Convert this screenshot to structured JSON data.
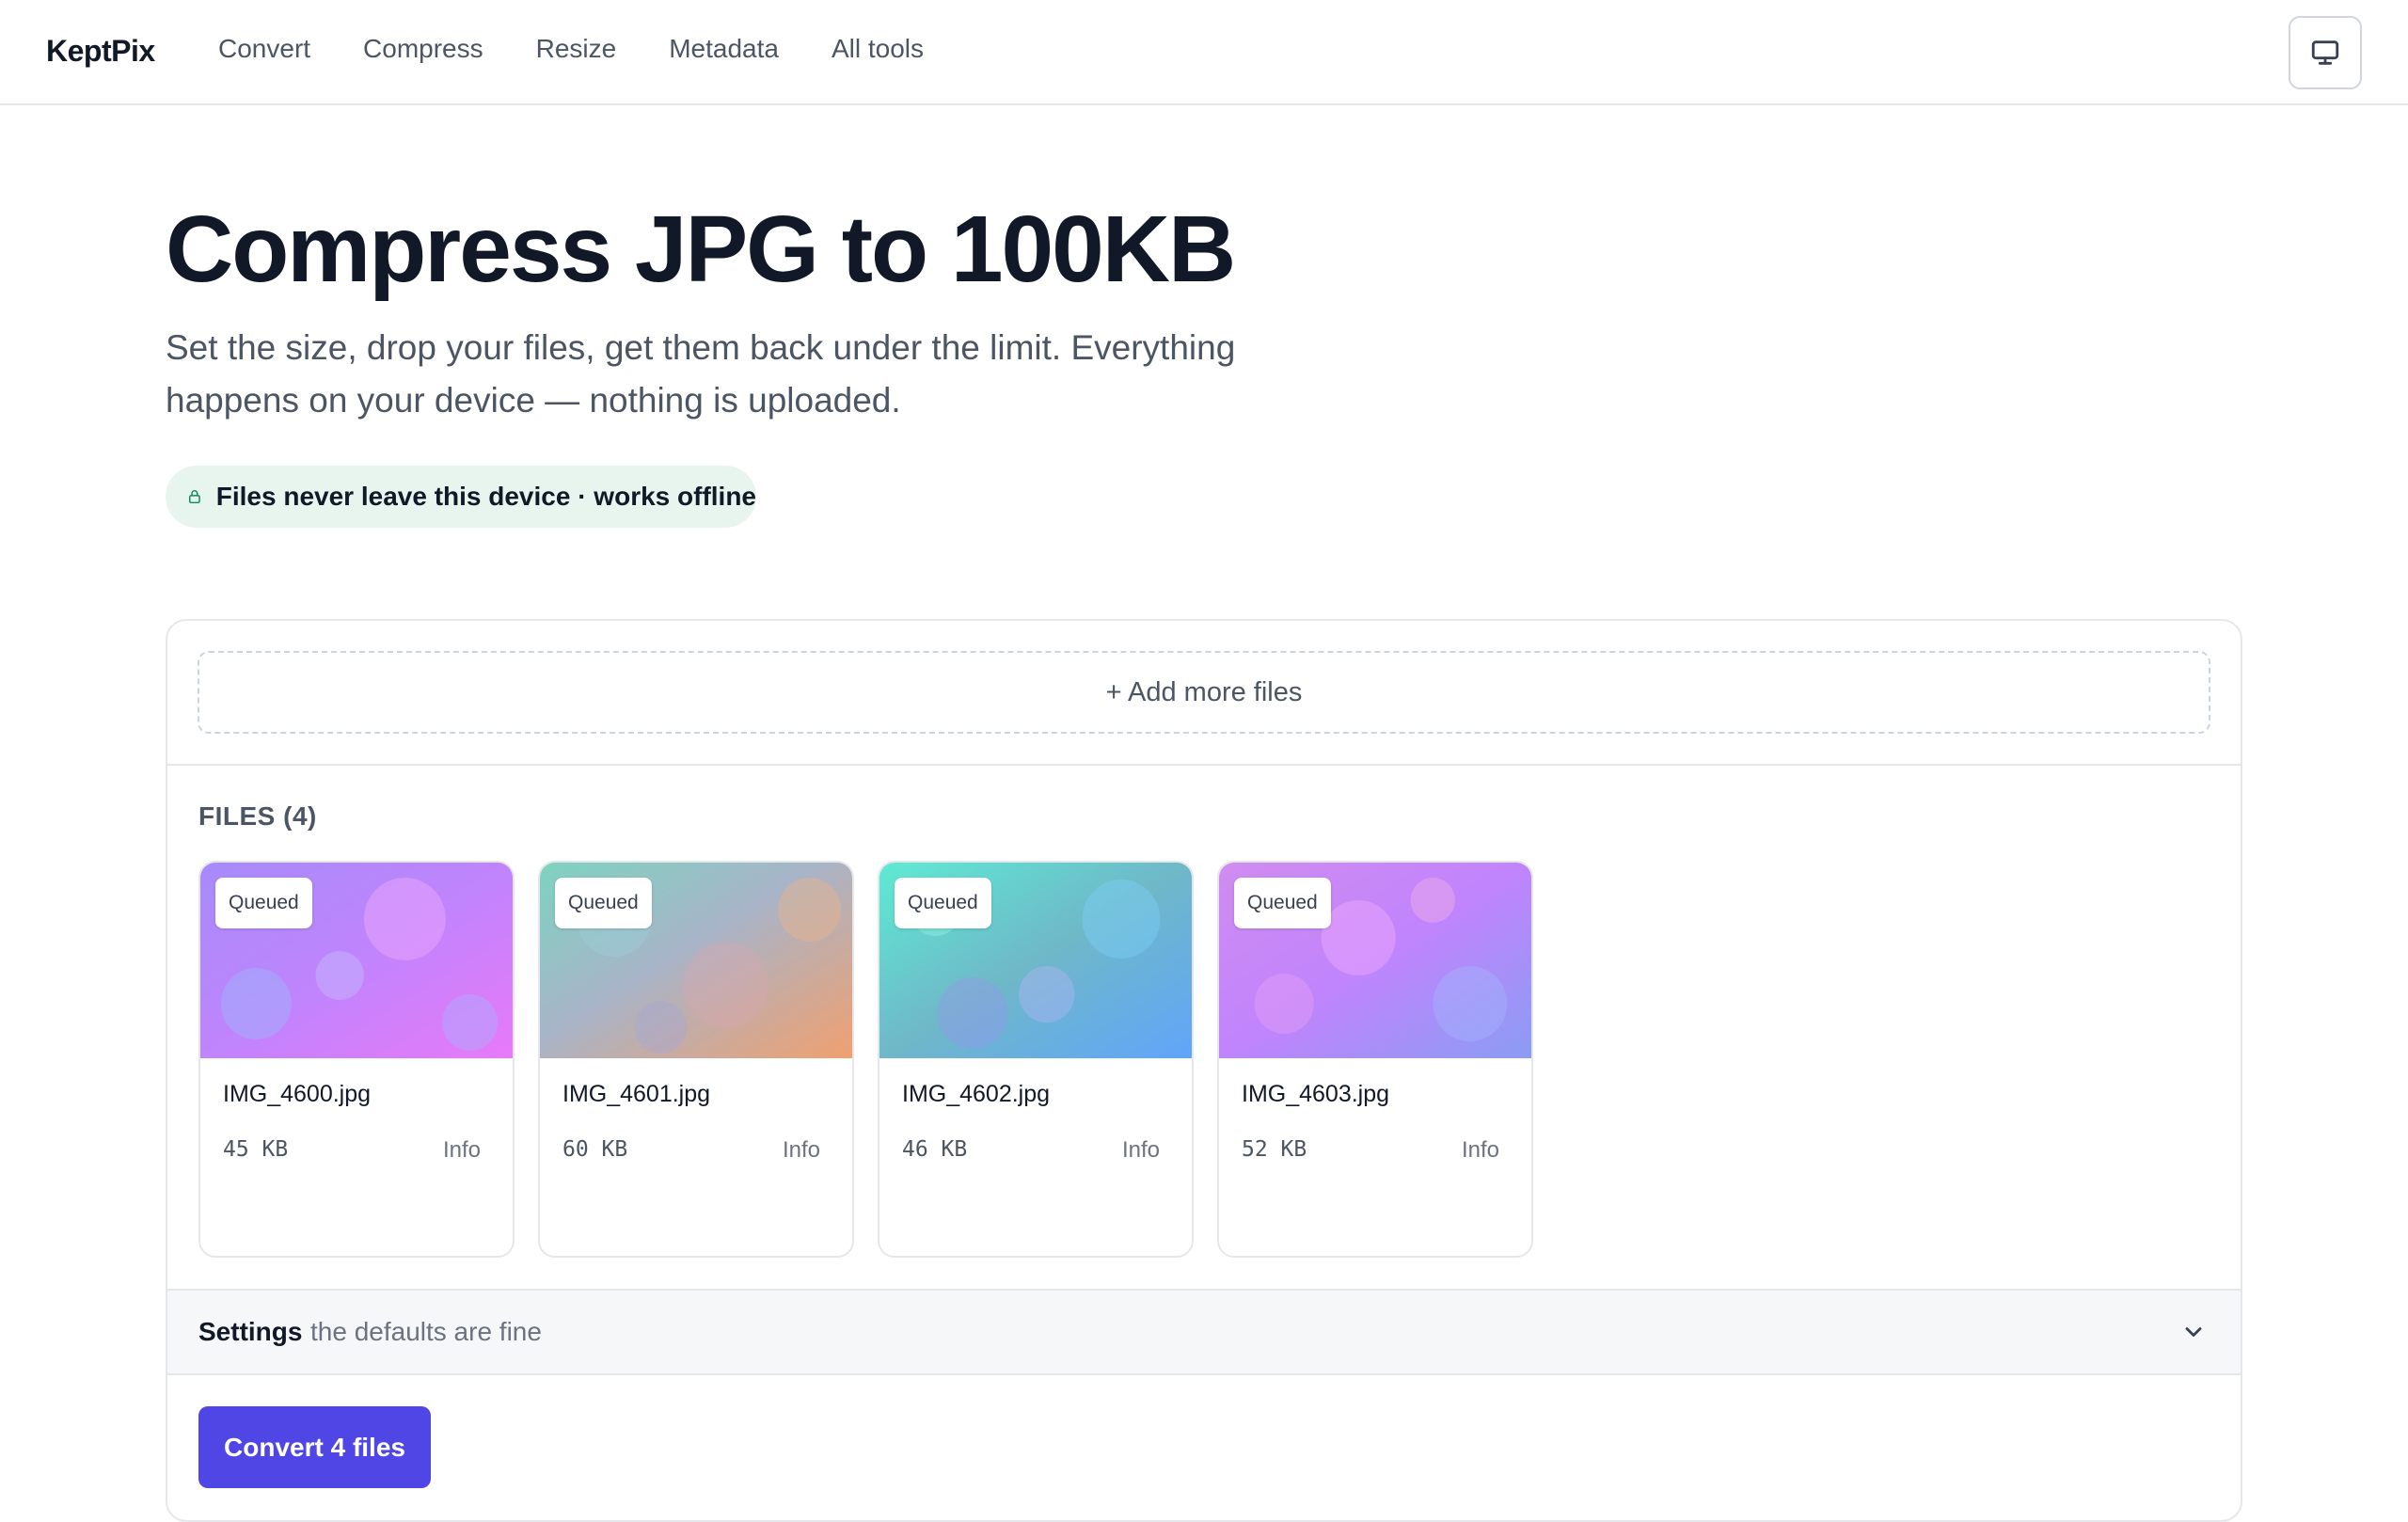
{
  "header": {
    "logo": "KeptPix",
    "nav": [
      "Convert",
      "Compress",
      "Resize",
      "Metadata",
      "All tools"
    ],
    "device_icon": "monitor-icon"
  },
  "hero": {
    "title": "Compress JPG to 100KB",
    "subtitle": "Set the size, drop your files, get them back under the limit. Everything happens on your device — nothing is uploaded.",
    "badge": {
      "icon": "lock-icon",
      "label": "Files never leave this device · works offline"
    }
  },
  "tool": {
    "add_files_label": "+ Add more files",
    "files_heading": "FILES (4)",
    "files": [
      {
        "name": "IMG_4600.jpg",
        "size": "45 KB",
        "status": "Queued",
        "info_label": "Info"
      },
      {
        "name": "IMG_4601.jpg",
        "size": "60 KB",
        "status": "Queued",
        "info_label": "Info"
      },
      {
        "name": "IMG_4602.jpg",
        "size": "46 KB",
        "status": "Queued",
        "info_label": "Info"
      },
      {
        "name": "IMG_4603.jpg",
        "size": "52 KB",
        "status": "Queued",
        "info_label": "Info"
      }
    ],
    "settings": {
      "label": "Settings",
      "hint": "the defaults are fine",
      "icon": "chevron-down-icon"
    },
    "convert_label": "Convert 4 files"
  },
  "colors": {
    "accent": "#4f46e5",
    "privacy_badge_bg": "#e8f5ef",
    "lock_icon": "#0f8a5f"
  }
}
